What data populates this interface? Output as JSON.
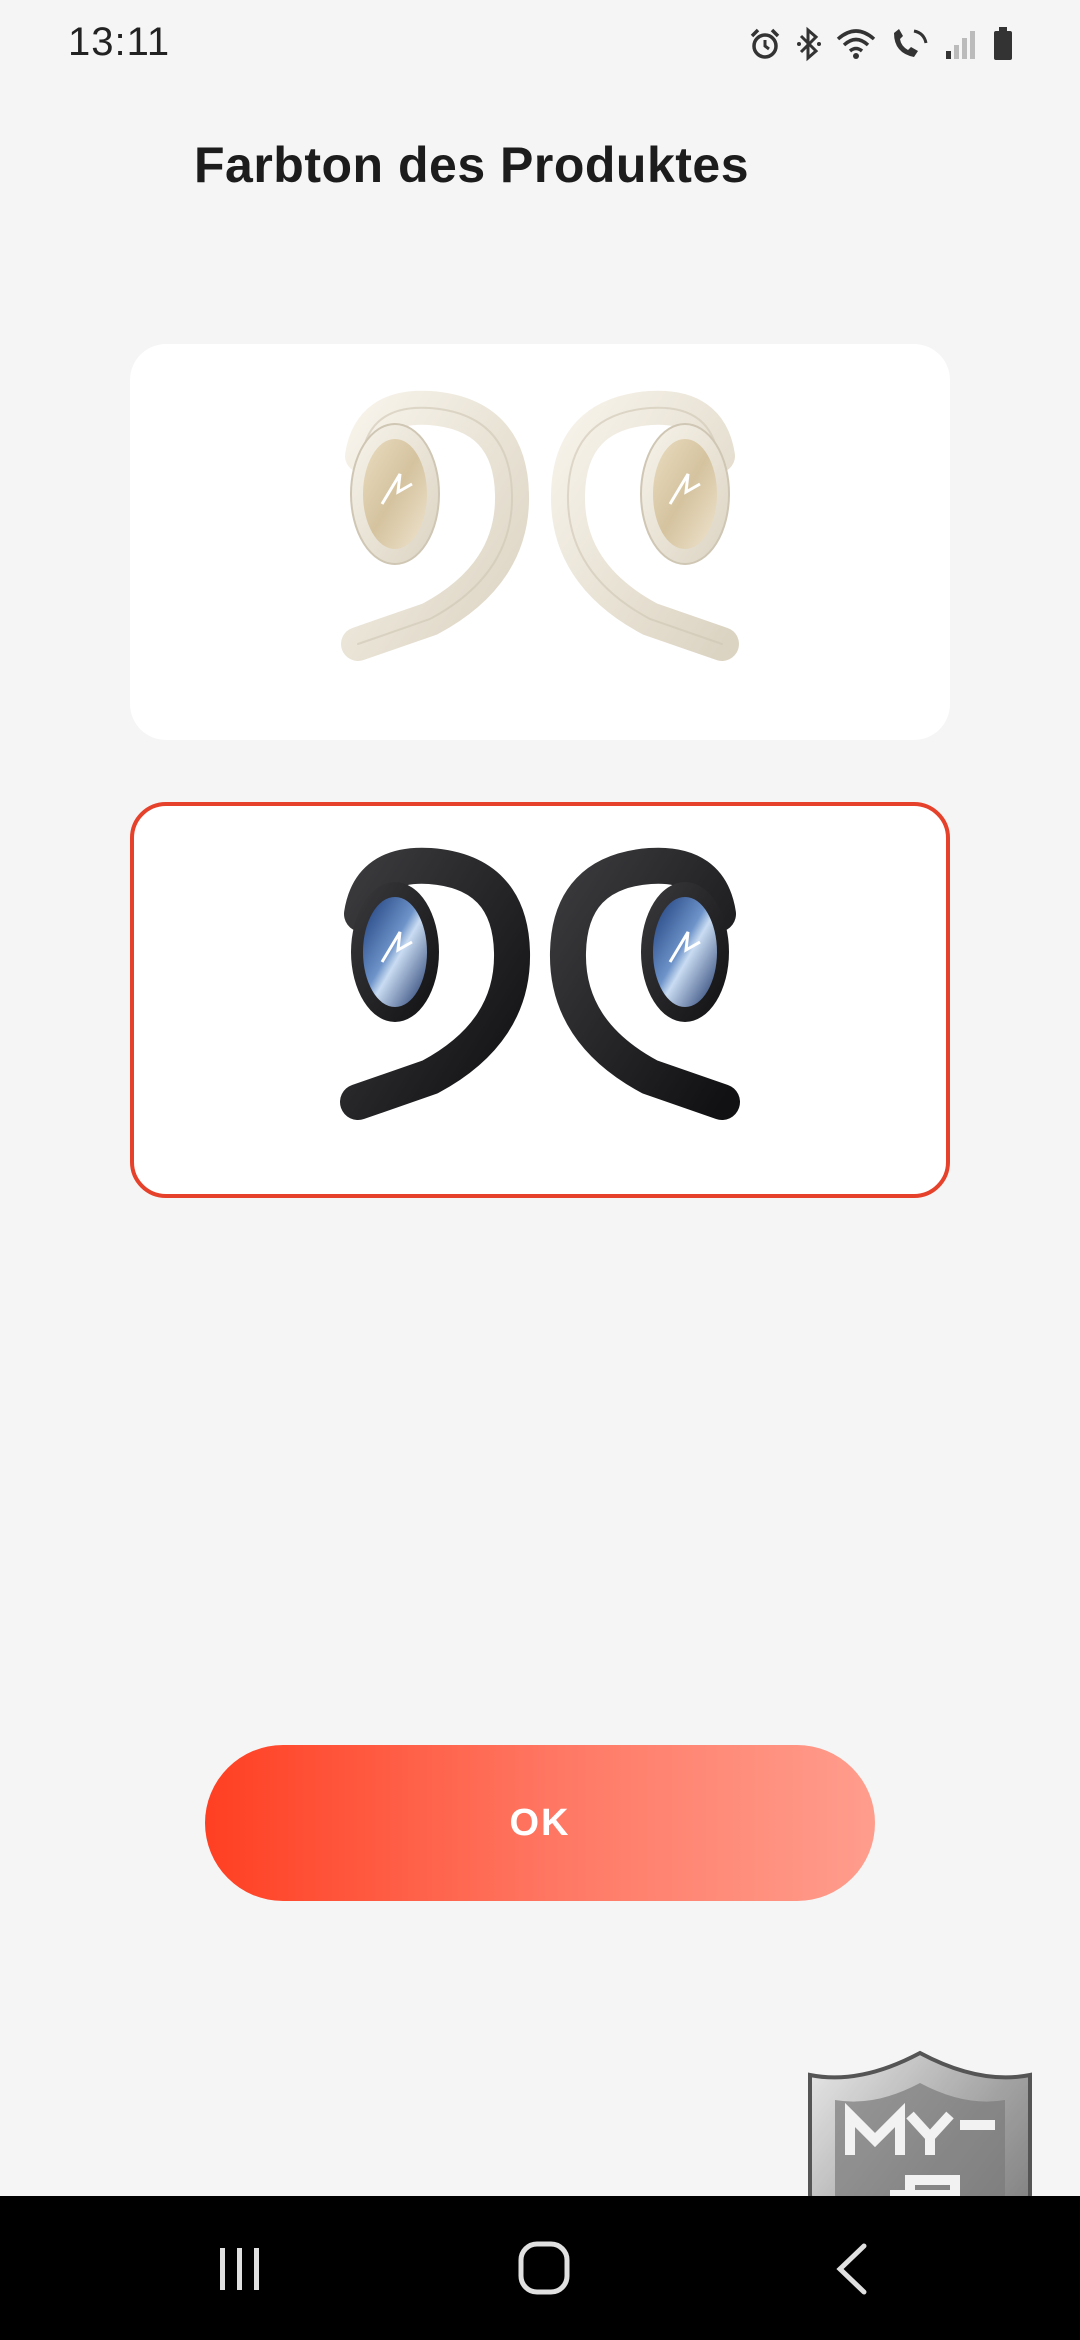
{
  "status_bar": {
    "time": "13:11",
    "icons": [
      "alarm-icon",
      "bluetooth-icon",
      "wifi-icon",
      "wifi-calling-icon",
      "signal-icon",
      "battery-icon"
    ]
  },
  "title": "Farbton des Produktes",
  "color_options": [
    {
      "name": "beige-earbuds",
      "selected": false,
      "color": "#ece6da"
    },
    {
      "name": "black-earbuds",
      "selected": true,
      "color": "#1e1e20"
    }
  ],
  "ok_button": {
    "label": "OK"
  },
  "colors": {
    "accent": "#e5412b",
    "button_gradient_start": "#ff3f22",
    "button_gradient_end": "#ff9d8d",
    "background": "#f5f5f5"
  },
  "nav_bar": {
    "buttons": [
      "recent-apps-icon",
      "home-icon",
      "back-icon"
    ]
  }
}
